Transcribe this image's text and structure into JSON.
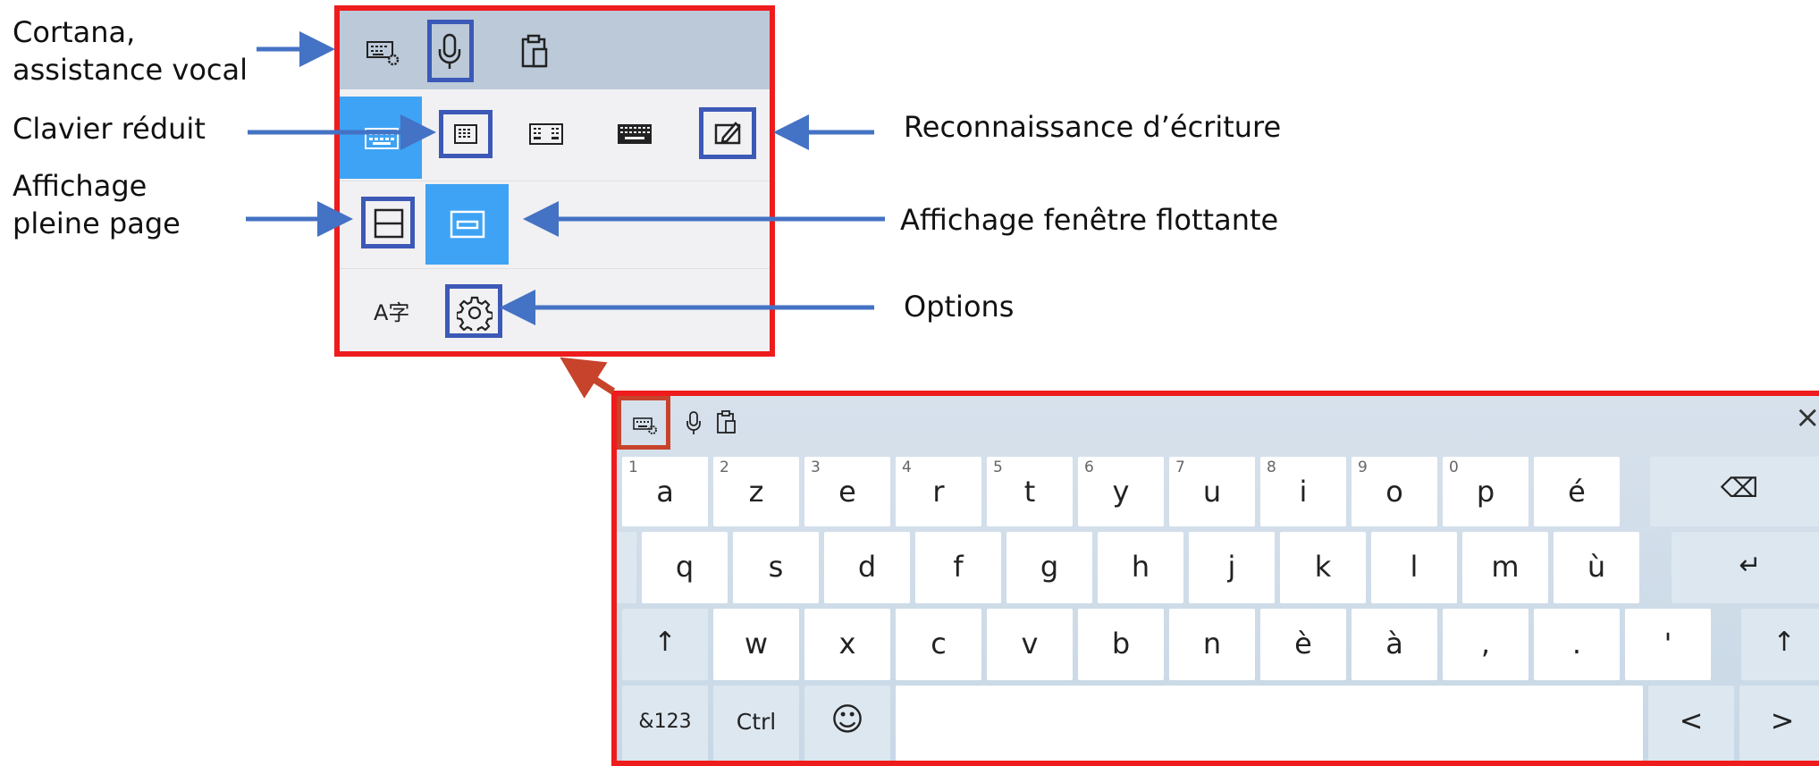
{
  "annotations": {
    "cortana": [
      "Cortana,",
      "assistance vocal"
    ],
    "compact": "Clavier réduit",
    "full_page": [
      "Affichage",
      "pleine page"
    ],
    "handwriting": "Reconnaissance d’écriture",
    "floating": "Affichage fenêtre flottante",
    "options": "Options"
  },
  "panel": {
    "toolbar_icons": [
      "keyboard-settings-icon",
      "microphone-icon",
      "clipboard-icon"
    ],
    "layout_icons": [
      "default-keyboard-icon",
      "compact-keyboard-icon",
      "split-keyboard-icon",
      "full-keyboard-icon",
      "handwriting-icon"
    ],
    "view_icons": [
      "docked-view-icon",
      "floating-view-icon"
    ],
    "bottom_icons": [
      "language-icon",
      "settings-gear-icon"
    ],
    "language_glyph": "A字",
    "accent_color": "#3ea3f4",
    "highlight_color": "#3c59b7",
    "border_color": "#ee1c1c"
  },
  "keyboard": {
    "close_glyph": "×",
    "row1": [
      {
        "num": "1",
        "ch": "a"
      },
      {
        "num": "2",
        "ch": "z"
      },
      {
        "num": "3",
        "ch": "e"
      },
      {
        "num": "4",
        "ch": "r"
      },
      {
        "num": "5",
        "ch": "t"
      },
      {
        "num": "6",
        "ch": "y"
      },
      {
        "num": "7",
        "ch": "u"
      },
      {
        "num": "8",
        "ch": "i"
      },
      {
        "num": "9",
        "ch": "o"
      },
      {
        "num": "0",
        "ch": "p"
      },
      {
        "num": "",
        "ch": "é"
      }
    ],
    "backspace": "⌫",
    "row2": [
      "q",
      "s",
      "d",
      "f",
      "g",
      "h",
      "j",
      "k",
      "l",
      "m",
      "ù"
    ],
    "enter": "↵",
    "row3": [
      "w",
      "x",
      "c",
      "v",
      "b",
      "n",
      "è",
      "à",
      ",",
      ".",
      "'"
    ],
    "shift": "↑",
    "row4": {
      "symbols": "&123",
      "ctrl": "Ctrl",
      "emoji": "☺",
      "left": "<",
      "right": ">"
    }
  }
}
